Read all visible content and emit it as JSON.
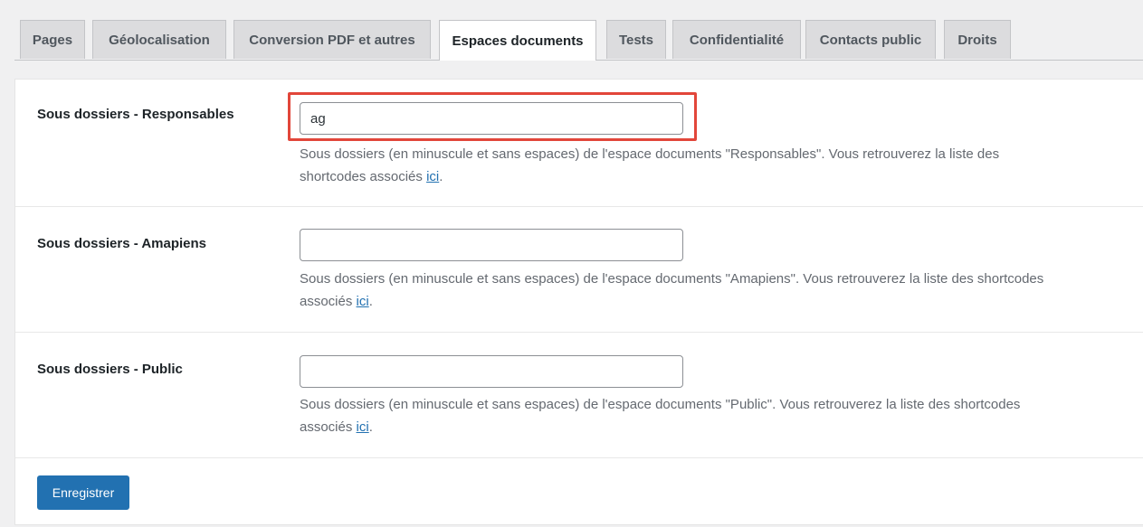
{
  "tabs": [
    {
      "label": "Pages"
    },
    {
      "label": "Géolocalisation"
    },
    {
      "label": "Conversion PDF et autres"
    },
    {
      "label": "Espaces documents"
    },
    {
      "label": "Tests"
    },
    {
      "label": "Confidentialité"
    },
    {
      "label": "Contacts public"
    },
    {
      "label": "Droits"
    }
  ],
  "active_tab": "Espaces documents",
  "fields": [
    {
      "label": "Sous dossiers - Responsables",
      "value": "ag",
      "desc_line1": "Sous dossiers (en minuscule et sans espaces) de l'espace documents \"Responsables\". Vous retrouverez la liste des",
      "desc_line2_prefix": "shortcodes associés ",
      "link": "ici",
      "desc_suffix": "."
    },
    {
      "label": "Sous dossiers - Amapiens",
      "value": "",
      "desc_line1": "Sous dossiers (en minuscule et sans espaces) de l'espace documents \"Amapiens\". Vous retrouverez la liste des shortcodes",
      "desc_line2_prefix": "associés ",
      "link": "ici",
      "desc_suffix": "."
    },
    {
      "label": "Sous dossiers - Public",
      "value": "",
      "desc_line1": "Sous dossiers (en minuscule et sans espaces) de l'espace documents \"Public\". Vous retrouverez la liste des shortcodes",
      "desc_line2_prefix": "associés ",
      "link": "ici",
      "desc_suffix": "."
    }
  ],
  "save_label": "Enregistrer",
  "colors": {
    "primary": "#2271b1",
    "highlight": "#e2463a"
  }
}
